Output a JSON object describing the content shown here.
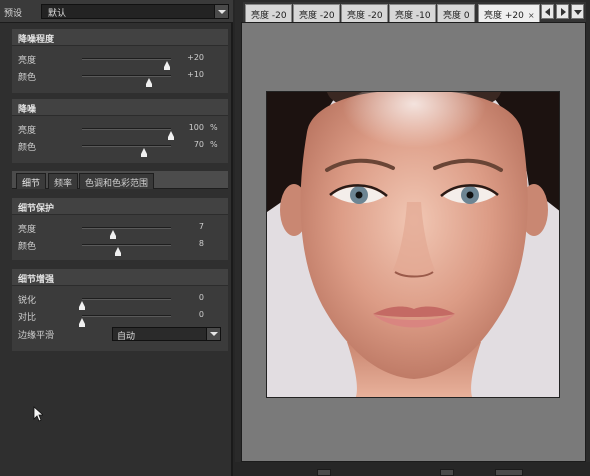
{
  "preset": {
    "label": "预设",
    "value": "默认"
  },
  "noise_amount": {
    "title": "降噪程度",
    "rows": [
      {
        "label": "亮度",
        "value": "+20",
        "unit": "",
        "level": 0.96
      },
      {
        "label": "颜色",
        "value": "+10",
        "unit": "",
        "level": 0.75
      }
    ]
  },
  "noise_reduction": {
    "title": "降噪",
    "rows": [
      {
        "label": "亮度",
        "value": "100",
        "unit": "%",
        "level": 1.0
      },
      {
        "label": "颜色",
        "value": "70",
        "unit": "%",
        "level": 0.7
      }
    ]
  },
  "tabs": [
    {
      "label": "细节"
    },
    {
      "label": "频率"
    },
    {
      "label": "色调和色彩范围"
    }
  ],
  "detail_protect": {
    "title": "细节保护",
    "rows": [
      {
        "label": "亮度",
        "value": "7",
        "unit": "",
        "level": 0.35
      },
      {
        "label": "颜色",
        "value": "8",
        "unit": "",
        "level": 0.4
      }
    ]
  },
  "detail_enhance": {
    "title": "细节增强",
    "rows": [
      {
        "label": "锐化",
        "value": "0",
        "unit": "",
        "level": 0.0
      },
      {
        "label": "对比",
        "value": "0",
        "unit": "",
        "level": 0.0
      }
    ],
    "edge_label": "边缘平滑",
    "edge_value": "自动"
  },
  "doc_tabs": [
    {
      "label": "亮度 -20"
    },
    {
      "label": "亮度 -20"
    },
    {
      "label": "亮度 -20"
    },
    {
      "label": "亮度 -10"
    },
    {
      "label": "亮度 0"
    },
    {
      "label": "亮度 +20",
      "close": "×"
    }
  ],
  "colors": {
    "panel": "#2f2f2f",
    "section": "#3b3b3b",
    "canvas": "#7a7a7a",
    "tab_active": "#efefef"
  }
}
